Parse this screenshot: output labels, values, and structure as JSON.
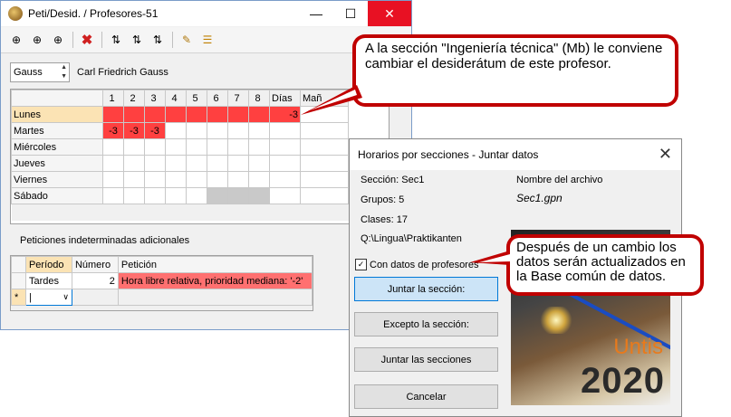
{
  "window": {
    "title": "Peti/Desid. / Profesores-51",
    "min_glyph": "—",
    "max_glyph": "☐",
    "close_glyph": "✕"
  },
  "toolbar": {
    "icons": [
      "add-row-icon",
      "add-row-icon",
      "add-row-icon",
      "delete-icon",
      "move-icon",
      "move-icon",
      "move-icon",
      "edit-icon",
      "list-icon"
    ]
  },
  "teacher": {
    "short": "Gauss",
    "name": "Carl Friedrich Gauss"
  },
  "timetable": {
    "columns": [
      "1",
      "2",
      "3",
      "4",
      "5",
      "6",
      "7",
      "8",
      "Días",
      "Mañ"
    ],
    "rows": [
      {
        "day": "Lunes",
        "cells": [
          "",
          "",
          "",
          "",
          "",
          "",
          "",
          "",
          "-3",
          ""
        ]
      },
      {
        "day": "Martes",
        "cells": [
          "-3",
          "-3",
          "-3",
          "",
          "",
          "",
          "",
          "",
          "",
          ""
        ]
      },
      {
        "day": "Miércoles",
        "cells": [
          "",
          "",
          "",
          "",
          "",
          "",
          "",
          "",
          "",
          ""
        ]
      },
      {
        "day": "Jueves",
        "cells": [
          "",
          "",
          "",
          "",
          "",
          "",
          "",
          "",
          "",
          ""
        ]
      },
      {
        "day": "Viernes",
        "cells": [
          "",
          "",
          "",
          "",
          "",
          "",
          "",
          "",
          "",
          ""
        ]
      },
      {
        "day": "Sábado",
        "cells": [
          "",
          "",
          "",
          "",
          "",
          "",
          "",
          "",
          "",
          ""
        ]
      }
    ]
  },
  "extra": {
    "label": "Peticiones indeterminadas adicionales",
    "headers": [
      "Período",
      "Número",
      "Petición"
    ],
    "row": {
      "periodo": "Tardes",
      "numero": "2",
      "peticion": "Hora libre relativa, prioridad mediana: '-2'"
    },
    "new_marker": "*"
  },
  "callout1": {
    "text": "A la sección \"Ingeniería técnica\" (Mb) le conviene cambiar el desiderátum de este profesor."
  },
  "callout2": {
    "text": "Después de un cambio los datos serán actualizados en la Base común de datos."
  },
  "dialog": {
    "title": "Horarios por secciones - Juntar datos",
    "seccion": "Sección: Sec1",
    "grupos": "Grupos: 5",
    "clases": "Clases: 17",
    "path": "Q:\\Lingua\\Praktikanten",
    "file_label": "Nombre del archivo",
    "file_name": "Sec1.gpn",
    "checkbox_label": "Con datos de profesores",
    "checkbox_checked": true,
    "btn_juntar_seccion": "Juntar la sección:",
    "btn_excepto": "Excepto la sección:",
    "btn_juntar_secciones": "Juntar las secciones",
    "btn_cancelar": "Cancelar",
    "logo_word": "Untis",
    "logo_year": "2020"
  },
  "colors": {
    "red_cell": "#ff4040",
    "callout_border": "#c00000",
    "selected_day": "#fbe3b4"
  }
}
